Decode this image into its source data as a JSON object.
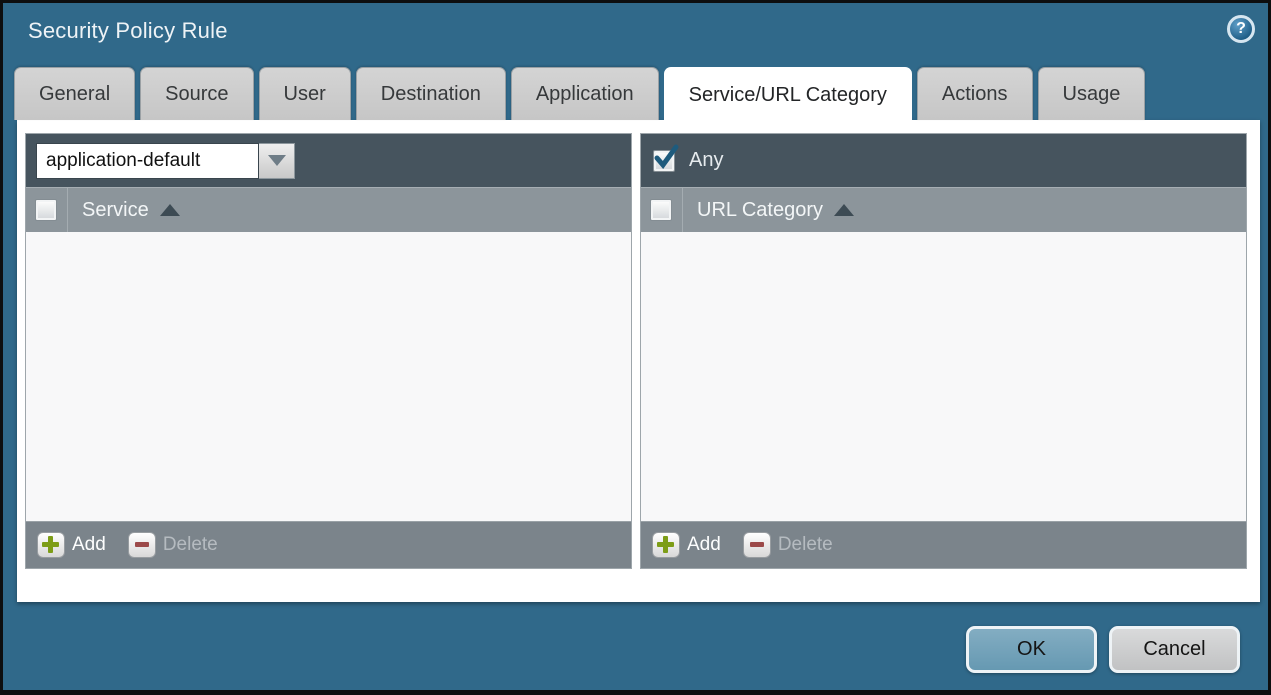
{
  "window": {
    "title": "Security Policy Rule",
    "help_label": "?"
  },
  "tabs": [
    {
      "label": "General",
      "active": false
    },
    {
      "label": "Source",
      "active": false
    },
    {
      "label": "User",
      "active": false
    },
    {
      "label": "Destination",
      "active": false
    },
    {
      "label": "Application",
      "active": false
    },
    {
      "label": "Service/URL Category",
      "active": true
    },
    {
      "label": "Actions",
      "active": false
    },
    {
      "label": "Usage",
      "active": false
    }
  ],
  "service_panel": {
    "service_selector": {
      "value": "application-default"
    },
    "column_header": "Service",
    "sort": "ascending",
    "items": [],
    "toolbar": {
      "add_label": "Add",
      "delete_label": "Delete",
      "delete_enabled": false
    }
  },
  "url_category_panel": {
    "any_checkbox": {
      "label": "Any",
      "checked": true
    },
    "column_header": "URL Category",
    "sort": "ascending",
    "items": [],
    "toolbar": {
      "add_label": "Add",
      "delete_label": "Delete",
      "delete_enabled": false
    }
  },
  "footer": {
    "ok_label": "OK",
    "cancel_label": "Cancel"
  },
  "colors": {
    "titlebar_background": "#30698a",
    "panel_header": "#46545e",
    "column_header": "#8c959b",
    "toolbar_background": "#7b848b",
    "active_tab": "#ffffff",
    "inactive_tab": "#cdcdcd",
    "ok_button": "#6fa1ba",
    "cancel_button": "#cccccc",
    "add_icon_green": "#7d9d17",
    "delete_icon_red": "#9c4a4a",
    "checkmark_blue": "#1e5b7d"
  }
}
